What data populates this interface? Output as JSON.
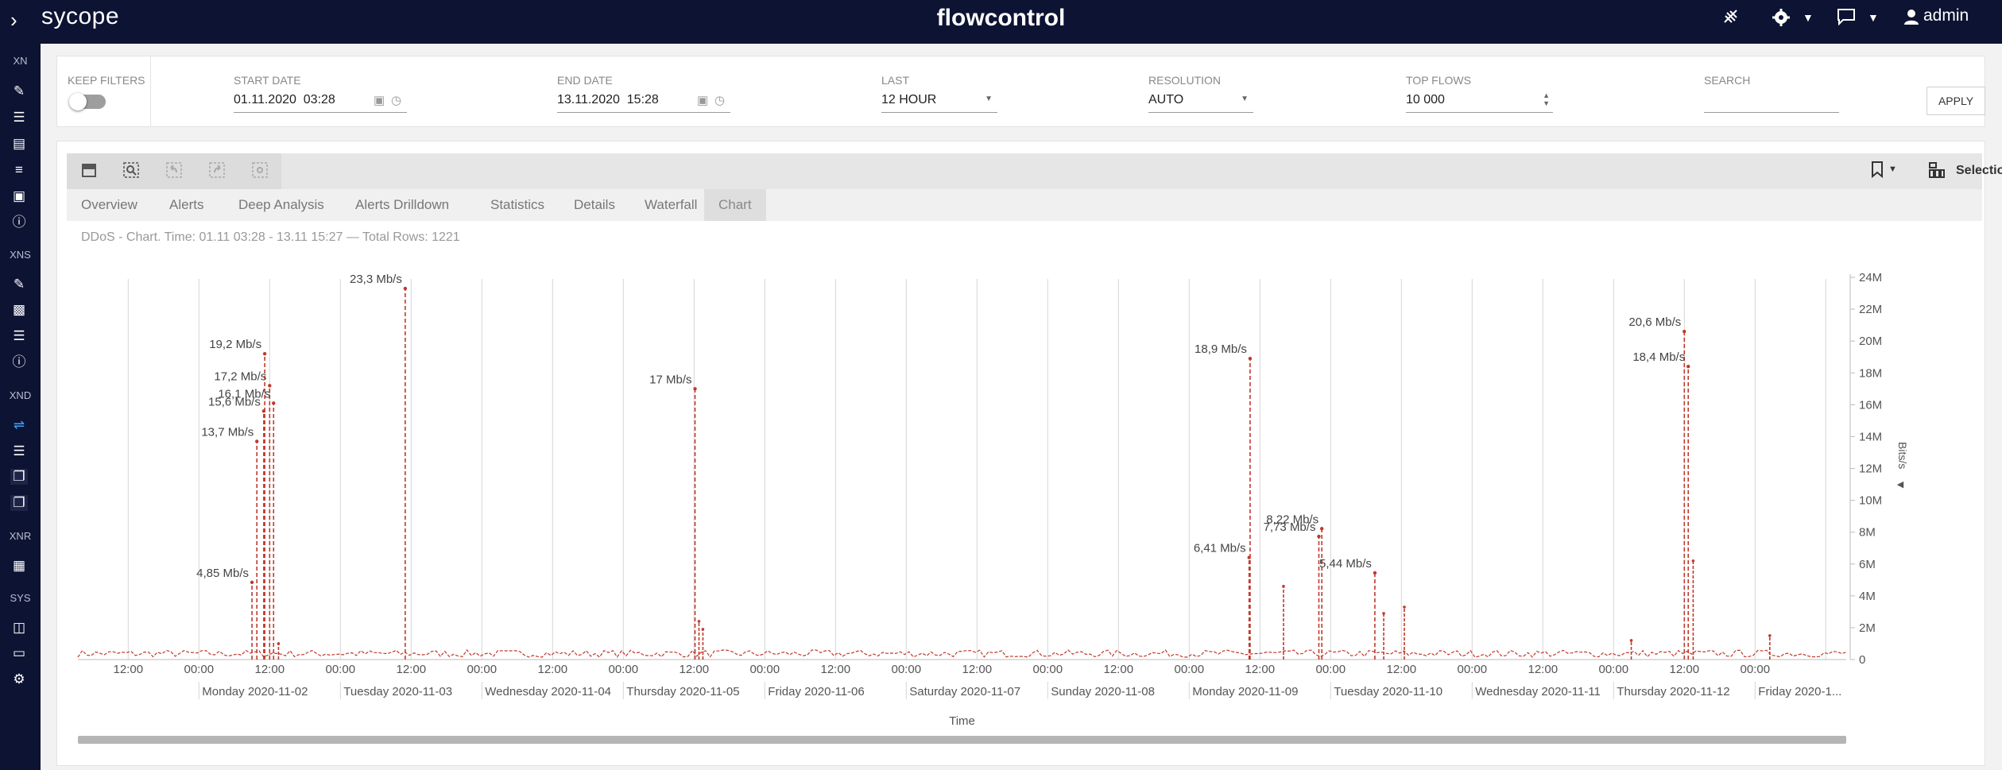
{
  "app": {
    "logo_text": "sycope",
    "title": "flowcontrol",
    "user": "admin"
  },
  "topbar_icons": [
    "antenna-off-icon",
    "gear-icon",
    "chat-icon",
    "user-icon"
  ],
  "sidebar": {
    "sections": [
      {
        "label": "XN",
        "icons": [
          "edit-icon",
          "list-icon",
          "stack-icon",
          "menu-icon",
          "calendar-icon",
          "info-icon"
        ]
      },
      {
        "label": "XNS",
        "icons": [
          "edit-icon",
          "image-icon",
          "list-icon",
          "info-icon"
        ]
      },
      {
        "label": "XND",
        "icons": [
          "flow-icon",
          "list-icon",
          "cards-icon",
          "cards-icon"
        ]
      },
      {
        "label": "XNR",
        "icons": [
          "grid-icon"
        ]
      },
      {
        "label": "SYS",
        "icons": [
          "layout-icon",
          "monitor-icon",
          "settings-circle-icon"
        ]
      }
    ]
  },
  "filters": {
    "keep_filters": {
      "label": "KEEP FILTERS",
      "on": false
    },
    "start_date": {
      "label": "START DATE",
      "value": "01.11.2020  03:28"
    },
    "end_date": {
      "label": "END DATE",
      "value": "13.11.2020  15:28"
    },
    "last": {
      "label": "LAST",
      "value": "12 HOUR"
    },
    "resolution": {
      "label": "RESOLUTION",
      "value": "AUTO"
    },
    "top_flows": {
      "label": "TOP FLOWS",
      "value": "10 000"
    },
    "search": {
      "label": "SEARCH",
      "value": ""
    },
    "apply_label": "APPLY"
  },
  "toolbar": {
    "selections_label": "Selections"
  },
  "tabs": [
    "Overview",
    "Alerts",
    "Deep Analysis",
    "Alerts Drilldown",
    "Statistics",
    "Details",
    "Waterfall",
    "Chart"
  ],
  "active_tab": "Chart",
  "subtitle": "DDoS - Chart. Time: 01.11 03:28 - 13.11 15:27 — Total Rows: 1221",
  "chart_data": {
    "type": "line",
    "color": "#c0392b",
    "xlabel": "Time",
    "ylabel": "Bits/s",
    "ylim": [
      0,
      24
    ],
    "y_tick_labels": [
      "0",
      "2M",
      "4M",
      "6M",
      "8M",
      "10M",
      "12M",
      "14M",
      "16M",
      "18M",
      "20M",
      "22M",
      "24M"
    ],
    "x_tick_labels": [
      "12:00",
      "00:00",
      "12:00",
      "00:00",
      "12:00",
      "00:00",
      "12:00",
      "00:00",
      "12:00",
      "00:00",
      "12:00",
      "00:00",
      "12:00",
      "00:00",
      "12:00",
      "00:00",
      "12:00",
      "00:00",
      "12:00",
      "00:00",
      "12:00",
      "00:00",
      "12:00",
      "00:00"
    ],
    "day_labels": [
      "Monday 2020-11-02",
      "Tuesday 2020-11-03",
      "Wednesday 2020-11-04",
      "Thursday 2020-11-05",
      "Friday 2020-11-06",
      "Saturday 2020-11-07",
      "Sunday 2020-11-08",
      "Monday 2020-11-09",
      "Tuesday 2020-11-10",
      "Wednesday 2020-11-11",
      "Thursday 2020-11-12",
      "Friday 2020-1..."
    ],
    "peaks": [
      {
        "time": "2020-11-02 09:00",
        "y": 4.85,
        "label": "4,85 Mb/s"
      },
      {
        "time": "2020-11-02 09:50",
        "y": 13.7,
        "label": "13,7 Mb/s"
      },
      {
        "time": "2020-11-02 11:00",
        "y": 15.6,
        "label": "15,6 Mb/s"
      },
      {
        "time": "2020-11-02 11:10",
        "y": 19.2,
        "label": "19,2 Mb/s"
      },
      {
        "time": "2020-11-02 12:00",
        "y": 17.2,
        "label": "17,2 Mb/s"
      },
      {
        "time": "2020-11-02 12:40",
        "y": 16.1,
        "label": "16,1 Mb/s"
      },
      {
        "time": "2020-11-03 11:00",
        "y": 23.3,
        "label": "23,3 Mb/s"
      },
      {
        "time": "2020-11-05 12:10",
        "y": 17,
        "label": "17 Mb/s"
      },
      {
        "time": "2020-11-09 10:10",
        "y": 6.41,
        "label": "6,41 Mb/s"
      },
      {
        "time": "2020-11-09 10:20",
        "y": 18.9,
        "label": "18,9 Mb/s"
      },
      {
        "time": "2020-11-09 22:00",
        "y": 7.73,
        "label": "7,73 Mb/s"
      },
      {
        "time": "2020-11-09 22:30",
        "y": 8.22,
        "label": "8,22 Mb/s"
      },
      {
        "time": "2020-11-10 07:30",
        "y": 5.44,
        "label": "5,44 Mb/s"
      },
      {
        "time": "2020-11-12 12:00",
        "y": 20.6,
        "label": "20,6 Mb/s"
      },
      {
        "time": "2020-11-12 12:40",
        "y": 18.4,
        "label": "18,4 Mb/s"
      }
    ],
    "minor_spikes": [
      {
        "time": "2020-11-09 16:00",
        "y": 4.6
      },
      {
        "time": "2020-11-10 12:30",
        "y": 3.3
      },
      {
        "time": "2020-11-10 09:00",
        "y": 2.9
      },
      {
        "time": "2020-11-12 13:30",
        "y": 6.2
      },
      {
        "time": "2020-11-12 03:00",
        "y": 1.2
      },
      {
        "time": "2020-11-13 02:30",
        "y": 1.5
      },
      {
        "time": "2020-11-05 13:30",
        "y": 1.9
      },
      {
        "time": "2020-11-05 12:50",
        "y": 2.4
      },
      {
        "time": "2020-11-02 13:30",
        "y": 1.0
      }
    ]
  }
}
